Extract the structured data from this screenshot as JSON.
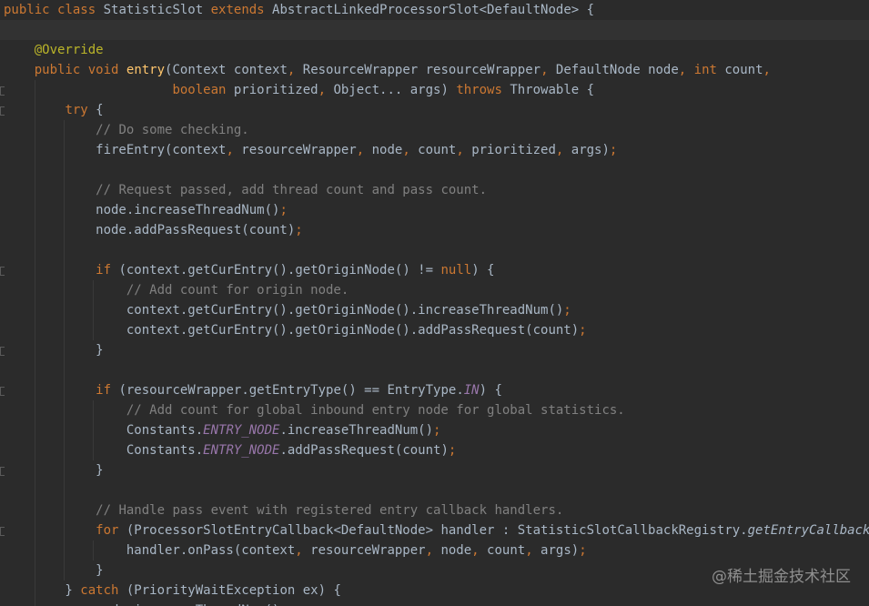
{
  "editor": {
    "lines": [
      {
        "tokens": [
          {
            "t": "kw",
            "v": "public "
          },
          {
            "t": "kw",
            "v": "class "
          },
          {
            "t": "pl",
            "v": "StatisticSlot "
          },
          {
            "t": "kw",
            "v": "extends "
          },
          {
            "t": "pl",
            "v": "AbstractLinkedProcessorSlot<DefaultNode> {"
          }
        ]
      },
      {
        "tokens": []
      },
      {
        "tokens": [
          {
            "t": "pl",
            "v": "    "
          },
          {
            "t": "ann",
            "v": "@Override"
          }
        ]
      },
      {
        "tokens": [
          {
            "t": "pl",
            "v": "    "
          },
          {
            "t": "kw",
            "v": "public "
          },
          {
            "t": "kw",
            "v": "void "
          },
          {
            "t": "fn",
            "v": "entry"
          },
          {
            "t": "pl",
            "v": "(Context context"
          },
          {
            "t": "kw",
            "v": ", "
          },
          {
            "t": "pl",
            "v": "ResourceWrapper resourceWrapper"
          },
          {
            "t": "kw",
            "v": ", "
          },
          {
            "t": "pl",
            "v": "DefaultNode node"
          },
          {
            "t": "kw",
            "v": ", "
          },
          {
            "t": "kw",
            "v": "int "
          },
          {
            "t": "pl",
            "v": "count"
          },
          {
            "t": "kw",
            "v": ","
          }
        ]
      },
      {
        "tokens": [
          {
            "t": "pl",
            "v": "                      "
          },
          {
            "t": "kw",
            "v": "boolean "
          },
          {
            "t": "pl",
            "v": "prioritized"
          },
          {
            "t": "kw",
            "v": ", "
          },
          {
            "t": "pl",
            "v": "Object... args) "
          },
          {
            "t": "kw",
            "v": "throws "
          },
          {
            "t": "pl",
            "v": "Throwable {"
          }
        ]
      },
      {
        "tokens": [
          {
            "t": "pl",
            "v": "        "
          },
          {
            "t": "kw",
            "v": "try "
          },
          {
            "t": "pl",
            "v": "{"
          }
        ]
      },
      {
        "tokens": [
          {
            "t": "pl",
            "v": "            "
          },
          {
            "t": "cm",
            "v": "// Do some checking."
          }
        ]
      },
      {
        "tokens": [
          {
            "t": "pl",
            "v": "            fireEntry(context"
          },
          {
            "t": "kw",
            "v": ", "
          },
          {
            "t": "pl",
            "v": "resourceWrapper"
          },
          {
            "t": "kw",
            "v": ", "
          },
          {
            "t": "pl",
            "v": "node"
          },
          {
            "t": "kw",
            "v": ", "
          },
          {
            "t": "pl",
            "v": "count"
          },
          {
            "t": "kw",
            "v": ", "
          },
          {
            "t": "pl",
            "v": "prioritized"
          },
          {
            "t": "kw",
            "v": ", "
          },
          {
            "t": "pl",
            "v": "args)"
          },
          {
            "t": "kw",
            "v": ";"
          }
        ]
      },
      {
        "tokens": []
      },
      {
        "tokens": [
          {
            "t": "pl",
            "v": "            "
          },
          {
            "t": "cm",
            "v": "// Request passed, add thread count and pass count."
          }
        ]
      },
      {
        "tokens": [
          {
            "t": "pl",
            "v": "            node.increaseThreadNum()"
          },
          {
            "t": "kw",
            "v": ";"
          }
        ]
      },
      {
        "tokens": [
          {
            "t": "pl",
            "v": "            node.addPassRequest(count)"
          },
          {
            "t": "kw",
            "v": ";"
          }
        ]
      },
      {
        "tokens": []
      },
      {
        "tokens": [
          {
            "t": "pl",
            "v": "            "
          },
          {
            "t": "kw",
            "v": "if "
          },
          {
            "t": "pl",
            "v": "(context.getCurEntry().getOriginNode() != "
          },
          {
            "t": "kw",
            "v": "null"
          },
          {
            "t": "pl",
            "v": ") {"
          }
        ]
      },
      {
        "tokens": [
          {
            "t": "pl",
            "v": "                "
          },
          {
            "t": "cm",
            "v": "// Add count for origin node."
          }
        ]
      },
      {
        "tokens": [
          {
            "t": "pl",
            "v": "                context.getCurEntry().getOriginNode().increaseThreadNum()"
          },
          {
            "t": "kw",
            "v": ";"
          }
        ]
      },
      {
        "tokens": [
          {
            "t": "pl",
            "v": "                context.getCurEntry().getOriginNode().addPassRequest(count)"
          },
          {
            "t": "kw",
            "v": ";"
          }
        ]
      },
      {
        "tokens": [
          {
            "t": "pl",
            "v": "            }"
          }
        ]
      },
      {
        "tokens": []
      },
      {
        "tokens": [
          {
            "t": "pl",
            "v": "            "
          },
          {
            "t": "kw",
            "v": "if "
          },
          {
            "t": "pl",
            "v": "(resourceWrapper.getEntryType() == EntryType."
          },
          {
            "t": "cst",
            "v": "IN"
          },
          {
            "t": "pl",
            "v": ") {"
          }
        ]
      },
      {
        "tokens": [
          {
            "t": "pl",
            "v": "                "
          },
          {
            "t": "cm",
            "v": "// Add count for global inbound entry node for global statistics."
          }
        ]
      },
      {
        "tokens": [
          {
            "t": "pl",
            "v": "                Constants."
          },
          {
            "t": "cst",
            "v": "ENTRY_NODE"
          },
          {
            "t": "pl",
            "v": ".increaseThreadNum()"
          },
          {
            "t": "kw",
            "v": ";"
          }
        ]
      },
      {
        "tokens": [
          {
            "t": "pl",
            "v": "                Constants."
          },
          {
            "t": "cst",
            "v": "ENTRY_NODE"
          },
          {
            "t": "pl",
            "v": ".addPassRequest(count)"
          },
          {
            "t": "kw",
            "v": ";"
          }
        ]
      },
      {
        "tokens": [
          {
            "t": "pl",
            "v": "            }"
          }
        ]
      },
      {
        "tokens": []
      },
      {
        "tokens": [
          {
            "t": "pl",
            "v": "            "
          },
          {
            "t": "cm",
            "v": "// Handle pass event with registered entry callback handlers."
          }
        ]
      },
      {
        "tokens": [
          {
            "t": "pl",
            "v": "            "
          },
          {
            "t": "kw",
            "v": "for "
          },
          {
            "t": "pl",
            "v": "(ProcessorSlotEntryCallback<DefaultNode> handler : StatisticSlotCallbackRegistry."
          },
          {
            "t": "st",
            "v": "getEntryCallbacks"
          },
          {
            "t": "pl",
            "v": "()) {"
          }
        ]
      },
      {
        "tokens": [
          {
            "t": "pl",
            "v": "                handler.onPass(context"
          },
          {
            "t": "kw",
            "v": ", "
          },
          {
            "t": "pl",
            "v": "resourceWrapper"
          },
          {
            "t": "kw",
            "v": ", "
          },
          {
            "t": "pl",
            "v": "node"
          },
          {
            "t": "kw",
            "v": ", "
          },
          {
            "t": "pl",
            "v": "count"
          },
          {
            "t": "kw",
            "v": ", "
          },
          {
            "t": "pl",
            "v": "args)"
          },
          {
            "t": "kw",
            "v": ";"
          }
        ]
      },
      {
        "tokens": [
          {
            "t": "pl",
            "v": "            }"
          }
        ]
      },
      {
        "tokens": [
          {
            "t": "pl",
            "v": "        } "
          },
          {
            "t": "kw",
            "v": "catch "
          },
          {
            "t": "pl",
            "v": "(PriorityWaitException ex) {"
          }
        ]
      },
      {
        "tokens": [
          {
            "t": "pl",
            "v": "            node.increaseThreadNum()"
          },
          {
            "t": "kw",
            "v": ";"
          }
        ]
      }
    ]
  },
  "watermark": {
    "text": "@稀土掘金技术社区"
  },
  "colors": {
    "background": "#2b2b2b",
    "current_line": "#323232",
    "keyword": "#cc7832",
    "function": "#ffc66d",
    "annotation": "#bbb529",
    "comment": "#808080",
    "constant": "#9876aa",
    "plain": "#a9b7c6"
  }
}
